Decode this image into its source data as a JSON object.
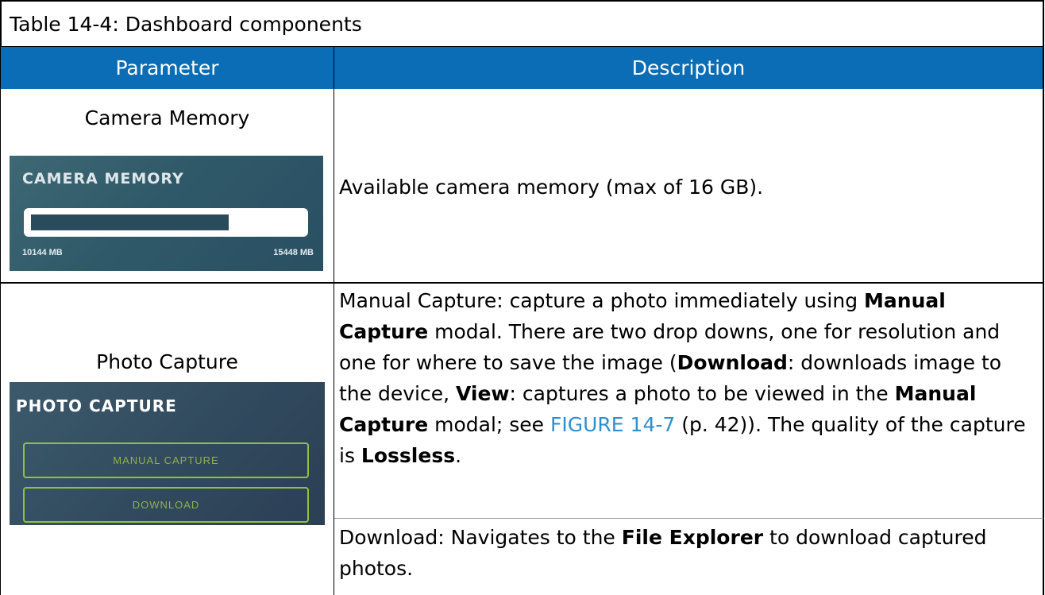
{
  "caption": "Table 14-4: Dashboard components",
  "headers": {
    "parameter": "Parameter",
    "description": "Description"
  },
  "rows": [
    {
      "parameter": "Camera Memory",
      "widget": {
        "title": "CAMERA MEMORY",
        "used_label": "10144 MB",
        "total_label": "15448 MB",
        "fill_fraction": 0.66
      },
      "description": "Available camera memory (max of 16 GB)."
    },
    {
      "parameter": "Photo Capture",
      "widget": {
        "title": "PHOTO CAPTURE",
        "manual_button": "MANUAL CAPTURE",
        "download_button": "DOWNLOAD"
      },
      "description_a": {
        "p1": "Manual Capture: capture a photo immediately using ",
        "b1": "Manual Capture",
        "p2": " modal. There are two drop downs, one for resolution and one for where to save the image (",
        "b2": "Download",
        "p3": ": downloads image to the device, ",
        "b3": "View",
        "p4": ": captures a photo to be viewed in the ",
        "b4": "Manual Capture",
        "p5": " modal; see ",
        "link": "FIGURE 14-7",
        "p6": " (p. 42)). The quality of the capture is ",
        "b5": "Lossless",
        "p7": "."
      },
      "description_b": {
        "p1": "Download: Navigates to the ",
        "b1": "File Explorer",
        "p2": " to download captured photos."
      }
    }
  ],
  "colors": {
    "header_bg": "#0b6db5",
    "link": "#2f8fd1",
    "button_border": "#8fc13f"
  }
}
